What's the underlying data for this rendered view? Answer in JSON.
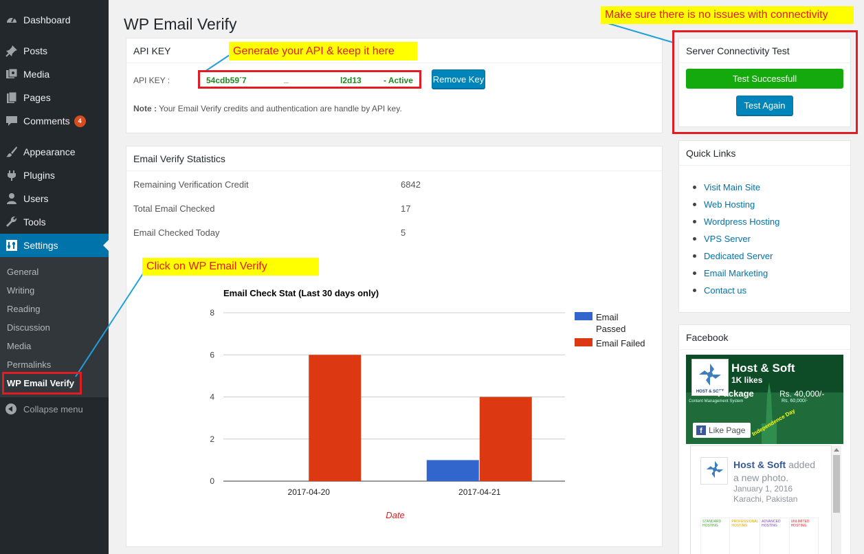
{
  "sidebar": {
    "items": [
      {
        "label": "Dashboard",
        "icon": "dashboard-icon"
      },
      {
        "label": "Posts",
        "icon": "pin-icon"
      },
      {
        "label": "Media",
        "icon": "media-icon"
      },
      {
        "label": "Pages",
        "icon": "pages-icon"
      },
      {
        "label": "Comments",
        "icon": "comment-icon",
        "badge": "4"
      },
      {
        "label": "Appearance",
        "icon": "brush-icon"
      },
      {
        "label": "Plugins",
        "icon": "plug-icon"
      },
      {
        "label": "Users",
        "icon": "user-icon"
      },
      {
        "label": "Tools",
        "icon": "wrench-icon"
      },
      {
        "label": "Settings",
        "icon": "settings-icon"
      }
    ],
    "submenu": [
      "General",
      "Writing",
      "Reading",
      "Discussion",
      "Media",
      "Permalinks",
      "WP Email Verify"
    ],
    "collapse_label": "Collapse menu"
  },
  "page": {
    "title": "WP Email Verify"
  },
  "api_box": {
    "header": "API KEY",
    "key_label": "API KEY :",
    "key_start": "54cdb59´7",
    "key_mid": "_",
    "key_end": "l2d13",
    "key_status": "- Active",
    "remove_button": "Remove Key",
    "note_label": "Note :",
    "note_text": "Your Email Verify credits and authentication are handle by API key."
  },
  "stats_box": {
    "header": "Email Verify Statistics",
    "rows": [
      {
        "label": "Remaining Verification Credit",
        "value": "6842"
      },
      {
        "label": "Total Email Checked",
        "value": "17"
      },
      {
        "label": "Email Checked Today",
        "value": "5"
      }
    ]
  },
  "chart_data": {
    "type": "bar",
    "title": "Email Check Stat (Last 30 days only)",
    "xlabel": "Date",
    "ylabel": "",
    "categories": [
      "2017-04-20",
      "2017-04-21"
    ],
    "series": [
      {
        "name": "Email Passed",
        "values": [
          0,
          1
        ],
        "color": "#3366cc"
      },
      {
        "name": "Email Failed",
        "values": [
          6,
          4
        ],
        "color": "#dc3912"
      }
    ],
    "ylim": [
      0,
      8
    ],
    "yticks": [
      "0",
      "2",
      "4",
      "6",
      "8"
    ],
    "legend_position": "right",
    "grid": true
  },
  "connectivity_box": {
    "header": "Server Connectivity Test",
    "status": "Test Successfull",
    "button": "Test Again"
  },
  "quick_links": {
    "header": "Quick Links",
    "links": [
      "Visit Main Site",
      "Web Hosting",
      "Wordpress Hosting",
      "VPS Server",
      "Dedicated Server",
      "Email Marketing",
      "Contact us"
    ]
  },
  "facebook": {
    "header": "Facebook",
    "page_name": "Host & Soft",
    "likes": "1K likes",
    "like_button": "Like Page",
    "banner_text": "Package",
    "banner_sub": "Content Management System",
    "banner_price": "Rs. 40,000/-",
    "banner_price_old": "Rs. 60,000/-",
    "banner_event": "Independence Day",
    "post_author": "Host & Soft",
    "post_action": "added",
    "post_action2": "a new photo.",
    "post_date": "January 1, 2016",
    "post_location": "Karachi, Pakistan",
    "logo_text": "HOST & SOFT",
    "plans": [
      "STANDARD HOSTING",
      "PROFESSIONAL HOSTING",
      "ADVANCED HOSTING",
      "UNLIMITED HOSTING"
    ]
  },
  "annotations": {
    "api": "Generate your API & keep it here",
    "connectivity": "Make sure there is no issues with connectivity",
    "menu": "Click on WP Email Verify"
  },
  "colors": {
    "accent": "#0073aa",
    "annotation": "#e31b23",
    "highlight": "#ffff00",
    "success": "#14a90c"
  }
}
